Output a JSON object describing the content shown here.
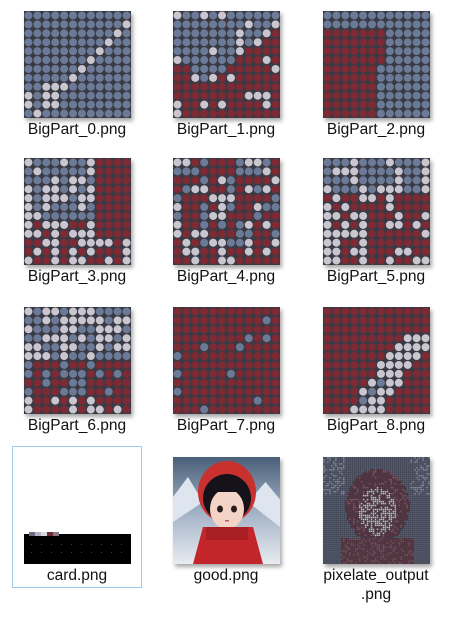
{
  "files": [
    {
      "name": "BigPart_0.png",
      "kind": "dots",
      "pattern": "diag"
    },
    {
      "name": "BigPart_1.png",
      "kind": "dots",
      "pattern": "wave_bottom"
    },
    {
      "name": "BigPart_2.png",
      "kind": "dots",
      "pattern": "redleft"
    },
    {
      "name": "BigPart_3.png",
      "kind": "dots",
      "pattern": "mixleft"
    },
    {
      "name": "BigPart_4.png",
      "kind": "dots",
      "pattern": "redmix"
    },
    {
      "name": "BigPart_5.png",
      "kind": "dots",
      "pattern": "redright"
    },
    {
      "name": "BigPart_6.png",
      "kind": "dots",
      "pattern": "topmix"
    },
    {
      "name": "BigPart_7.png",
      "kind": "dots",
      "pattern": "allred"
    },
    {
      "name": "BigPart_8.png",
      "kind": "dots",
      "pattern": "lightdiag"
    },
    {
      "name": "card.png",
      "kind": "card",
      "selected": true
    },
    {
      "name": "good.png",
      "kind": "photo"
    },
    {
      "name": "pixelate_output.png",
      "kind": "pixel",
      "label_lines": [
        "pixelate_output",
        ".png"
      ]
    }
  ],
  "colors": {
    "dark_bg": "#3a3a44",
    "blue": "#6b7a97",
    "light": "#c9c6cf",
    "red": "#7d2a34",
    "dark_dot": "#4a4650",
    "selection_border": "#9ccbf2"
  }
}
